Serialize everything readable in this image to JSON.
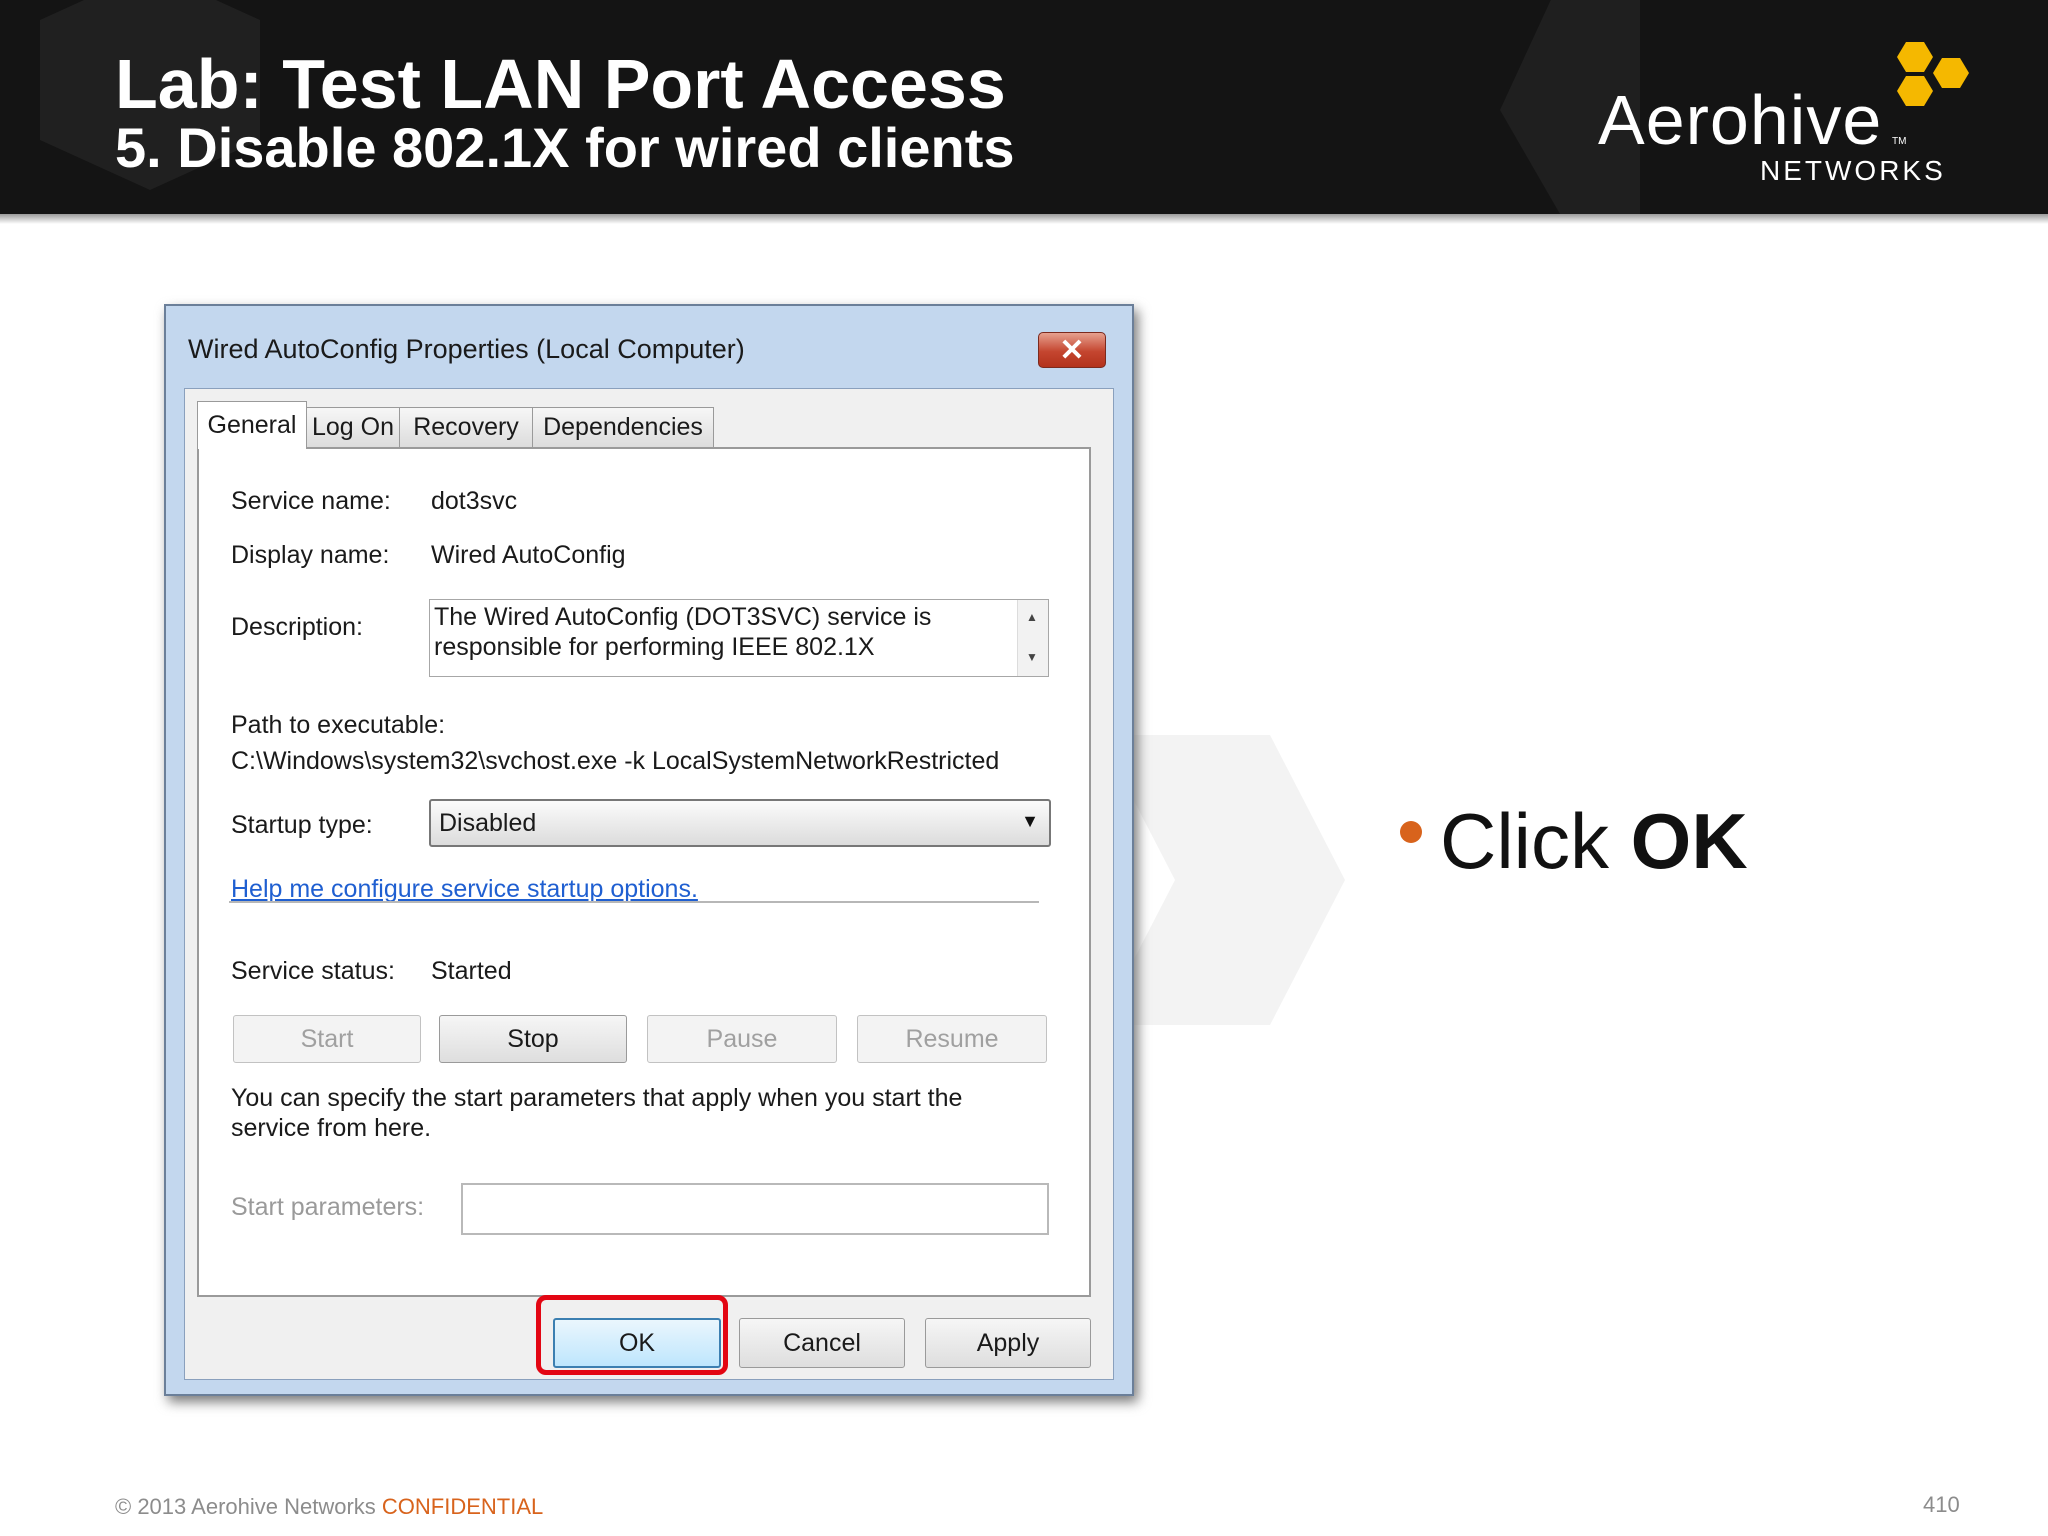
{
  "slide": {
    "title": "Lab: Test LAN Port Access",
    "subtitle": "5. Disable 802.1X for wired clients",
    "logo": {
      "word": "Aerohive",
      "tm": "TM",
      "sub": "NETWORKS"
    },
    "bullet": {
      "prefix": "Click ",
      "bold": "OK"
    },
    "footer": {
      "copyright": "© 2013 Aerohive Networks ",
      "confidential": "CONFIDENTIAL"
    },
    "page_number": "410",
    "colors": {
      "header_bg": "#141414",
      "accent_orange": "#d8631c",
      "logo_yellow": "#f5b800",
      "highlight_red": "#e30613"
    }
  },
  "dialog": {
    "title": "Wired AutoConfig Properties (Local Computer)",
    "close_icon": "close-icon",
    "tabs": [
      {
        "label": "General",
        "active": true
      },
      {
        "label": "Log On"
      },
      {
        "label": "Recovery"
      },
      {
        "label": "Dependencies"
      }
    ],
    "fields": {
      "service_name_label": "Service name:",
      "service_name_value": "dot3svc",
      "display_name_label": "Display name:",
      "display_name_value": "Wired AutoConfig",
      "description_label": "Description:",
      "description_value": "The Wired AutoConfig (DOT3SVC) service is responsible for performing IEEE 802.1X",
      "path_label": "Path to executable:",
      "path_value": "C:\\Windows\\system32\\svchost.exe -k LocalSystemNetworkRestricted",
      "startup_label": "Startup type:",
      "startup_value": "Disabled",
      "help_link": "Help me configure service startup options.",
      "status_label": "Service status:",
      "status_value": "Started",
      "params_note": "You can specify the start parameters that apply when you start the service from here.",
      "params_label": "Start parameters:",
      "params_value": ""
    },
    "service_buttons": [
      {
        "label": "Start",
        "enabled": false
      },
      {
        "label": "Stop",
        "enabled": true
      },
      {
        "label": "Pause",
        "enabled": false
      },
      {
        "label": "Resume",
        "enabled": false
      }
    ],
    "footer_buttons": [
      {
        "label": "OK",
        "highlighted": true
      },
      {
        "label": "Cancel"
      },
      {
        "label": "Apply"
      }
    ]
  }
}
